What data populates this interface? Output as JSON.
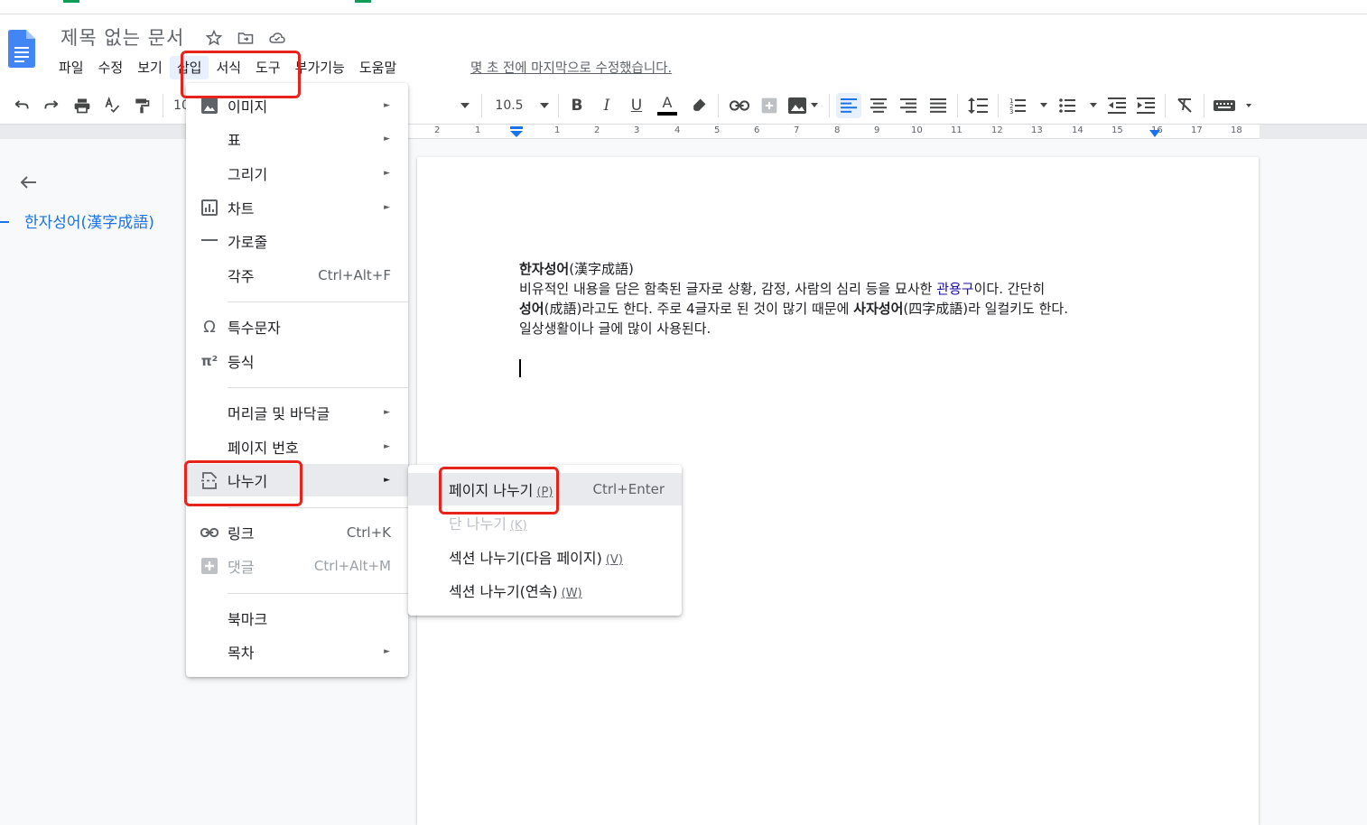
{
  "document": {
    "title": "제목 없는 문서",
    "last_edit": "몇 초 전에 마지막으로 수정했습니다."
  },
  "menubar": [
    "파일",
    "수정",
    "보기",
    "삽입",
    "서식",
    "도구",
    "부가기능",
    "도움말"
  ],
  "toolbar": {
    "font_size": "10.5",
    "font_size_partial": "10"
  },
  "ruler": {
    "numbers": [
      "2",
      "1",
      "1",
      "2",
      "3",
      "4",
      "5",
      "6",
      "7",
      "8",
      "9",
      "10",
      "11",
      "12",
      "13",
      "14",
      "15",
      "16",
      "17",
      "18"
    ]
  },
  "outline": {
    "item": "한자성어(漢字成語)"
  },
  "content": {
    "heading_bold": "한자성어",
    "heading_rest": "(漢字成語)",
    "line1_a": "비유적인 내용을 담은 함축된 글자로 상황, 감정, 사람의 심리 등을 묘사한 ",
    "line1_link": "관용구",
    "line1_b": "이다. 간단히",
    "line2_bold1": "성어",
    "line2_a": "(成語)라고도 한다. 주로 4글자로 된 것이 많기 때문에 ",
    "line2_bold2": "사자성어",
    "line2_b": "(四字成語)라 일컬키도 한다.",
    "line3": "일상생활이나 글에 많이 사용된다."
  },
  "insert_menu": {
    "items": [
      {
        "label": "이미지",
        "icon": "image-icon",
        "submenu": true
      },
      {
        "label": "표",
        "icon": "",
        "submenu": true
      },
      {
        "label": "그리기",
        "icon": "",
        "submenu": true
      },
      {
        "label": "차트",
        "icon": "chart-icon",
        "submenu": true
      },
      {
        "label": "가로줄",
        "icon": "horizontal-line-icon",
        "submenu": false
      },
      {
        "label": "각주",
        "icon": "",
        "shortcut": "Ctrl+Alt+F"
      },
      {
        "label": "특수문자",
        "icon": "omega-icon",
        "submenu": false
      },
      {
        "label": "등식",
        "icon": "pi-icon",
        "submenu": false
      },
      {
        "label": "머리글 및 바닥글",
        "icon": "",
        "submenu": true
      },
      {
        "label": "페이지 번호",
        "icon": "",
        "submenu": true
      },
      {
        "label": "나누기",
        "icon": "page-break-icon",
        "submenu": true
      },
      {
        "label": "링크",
        "icon": "link-icon",
        "shortcut": "Ctrl+K"
      },
      {
        "label": "댓글",
        "icon": "comment-add-icon",
        "shortcut": "Ctrl+Alt+M"
      },
      {
        "label": "북마크",
        "icon": "",
        "submenu": false
      },
      {
        "label": "목차",
        "icon": "",
        "submenu": true
      }
    ],
    "arrow": "►",
    "omega_glyph": "Ω",
    "pi_glyph": "π²"
  },
  "split_menu": {
    "items": [
      {
        "label": "페이지 나누기",
        "accel": "(P)",
        "shortcut": "Ctrl+Enter"
      },
      {
        "label": "단 나누기",
        "accel": "(K)",
        "shortcut": ""
      },
      {
        "label": "섹션 나누기(다음 페이지)",
        "accel": "(V)",
        "shortcut": ""
      },
      {
        "label": "섹션 나누기(연속)",
        "accel": "(W)",
        "shortcut": ""
      }
    ]
  },
  "colors": {
    "accent": "#1a73e8",
    "highlight_box": "#e8231c",
    "docs_blue": "#4285f4"
  }
}
